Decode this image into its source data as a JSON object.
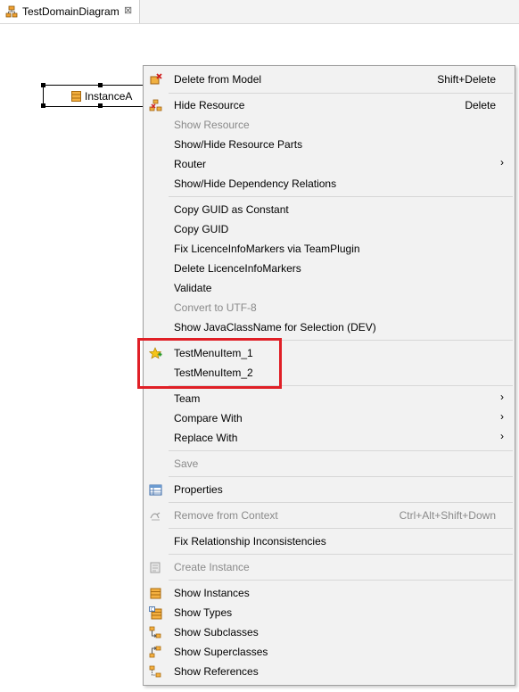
{
  "tab": {
    "title": "TestDomainDiagram",
    "close": "⊠"
  },
  "node": {
    "label": "InstanceA"
  },
  "menu": {
    "items": [
      {
        "label": "Delete from Model",
        "accel": "Shift+Delete",
        "icon": "delete-icon",
        "enabled": true
      },
      {
        "label": "Hide Resource",
        "accel": "Delete",
        "icon": "hide-resource-icon",
        "enabled": true
      },
      {
        "label": "Show Resource",
        "accel": "",
        "icon": "",
        "enabled": false
      },
      {
        "label": "Show/Hide Resource Parts",
        "accel": "",
        "icon": "",
        "enabled": true
      },
      {
        "label": "Router",
        "accel": "",
        "icon": "",
        "enabled": true,
        "submenu": true
      },
      {
        "label": "Show/Hide Dependency Relations",
        "accel": "",
        "icon": "",
        "enabled": true
      },
      {
        "label": "Copy GUID as Constant",
        "accel": "",
        "icon": "",
        "enabled": true
      },
      {
        "label": "Copy GUID",
        "accel": "",
        "icon": "",
        "enabled": true
      },
      {
        "label": "Fix LicenceInfoMarkers via TeamPlugin",
        "accel": "",
        "icon": "",
        "enabled": true
      },
      {
        "label": "Delete LicenceInfoMarkers",
        "accel": "",
        "icon": "",
        "enabled": true
      },
      {
        "label": "Validate",
        "accel": "",
        "icon": "",
        "enabled": true
      },
      {
        "label": "Convert to UTF-8",
        "accel": "",
        "icon": "",
        "enabled": false
      },
      {
        "label": "Show JavaClassName for Selection (DEV)",
        "accel": "",
        "icon": "",
        "enabled": true
      },
      {
        "label": "TestMenuItem_1",
        "accel": "",
        "icon": "star-plus-icon",
        "enabled": true
      },
      {
        "label": "TestMenuItem_2",
        "accel": "",
        "icon": "",
        "enabled": true
      },
      {
        "label": "Team",
        "accel": "",
        "icon": "",
        "enabled": true,
        "submenu": true
      },
      {
        "label": "Compare With",
        "accel": "",
        "icon": "",
        "enabled": true,
        "submenu": true
      },
      {
        "label": "Replace With",
        "accel": "",
        "icon": "",
        "enabled": true,
        "submenu": true
      },
      {
        "label": "Save",
        "accel": "",
        "icon": "",
        "enabled": false
      },
      {
        "label": "Properties",
        "accel": "",
        "icon": "properties-icon",
        "enabled": true
      },
      {
        "label": "Remove from Context",
        "accel": "Ctrl+Alt+Shift+Down",
        "icon": "remove-context-icon",
        "enabled": false
      },
      {
        "label": "Fix Relationship Inconsistencies",
        "accel": "",
        "icon": "",
        "enabled": true
      },
      {
        "label": "Create Instance",
        "accel": "",
        "icon": "create-instance-icon",
        "enabled": false
      },
      {
        "label": "Show Instances",
        "accel": "",
        "icon": "instances-icon",
        "enabled": true
      },
      {
        "label": "Show Types",
        "accel": "",
        "icon": "types-icon",
        "enabled": true
      },
      {
        "label": "Show Subclasses",
        "accel": "",
        "icon": "subclasses-icon",
        "enabled": true
      },
      {
        "label": "Show Superclasses",
        "accel": "",
        "icon": "superclasses-icon",
        "enabled": true
      },
      {
        "label": "Show References",
        "accel": "",
        "icon": "references-icon",
        "enabled": true
      }
    ]
  },
  "colors": {
    "highlight": "#e01f26",
    "menu_bg": "#f2f2f2",
    "disabled_text": "#8a8a8a"
  }
}
